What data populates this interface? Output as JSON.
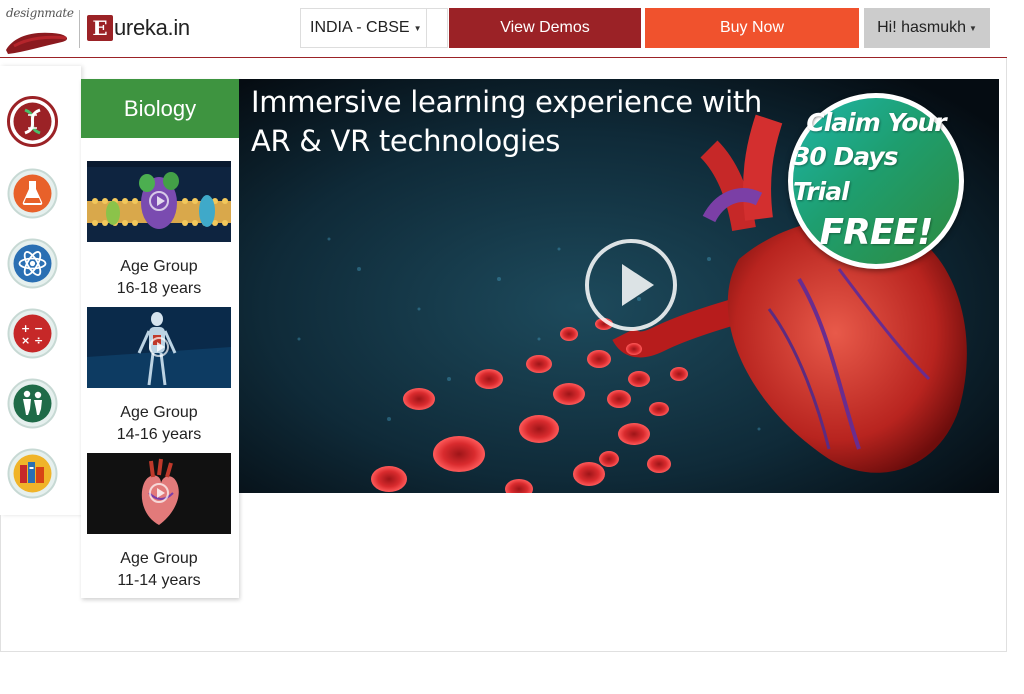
{
  "header": {
    "brand_logo_text": "designmate",
    "product_logo_letter": "E",
    "product_logo_text": "ureka.in",
    "curriculum": "INDIA - CBSE",
    "view_demos_label": "View Demos",
    "buy_now_label": "Buy Now",
    "user_greeting": "Hi! hasmukh"
  },
  "sidebar": {
    "subjects": [
      {
        "icon": "dna-icon",
        "selected": true
      },
      {
        "icon": "flask-icon",
        "selected": false
      },
      {
        "icon": "atom-icon",
        "selected": false
      },
      {
        "icon": "math-operators-icon",
        "selected": false
      },
      {
        "icon": "kids-icon",
        "selected": false
      },
      {
        "icon": "books-icon",
        "selected": false
      }
    ]
  },
  "modules": {
    "subject_title": "Biology",
    "items": [
      {
        "label": "Age Group",
        "age": "16-18 years",
        "thumbnail": "cell-membrane"
      },
      {
        "label": "Age Group",
        "age": "14-16 years",
        "thumbnail": "human-skeleton"
      },
      {
        "label": "Age Group",
        "age": "11-14 years",
        "thumbnail": "human-heart"
      }
    ]
  },
  "hero": {
    "headline_line1": "Immersive learning experience with",
    "headline_line2": "AR & VR technologies",
    "badge_line1": "Claim Your",
    "badge_line2": "30 Days Trial",
    "badge_line3": "FREE!"
  },
  "colors": {
    "brand_red": "#9b2226",
    "buy_orange": "#f0522d",
    "biology_green": "#3e9440"
  }
}
